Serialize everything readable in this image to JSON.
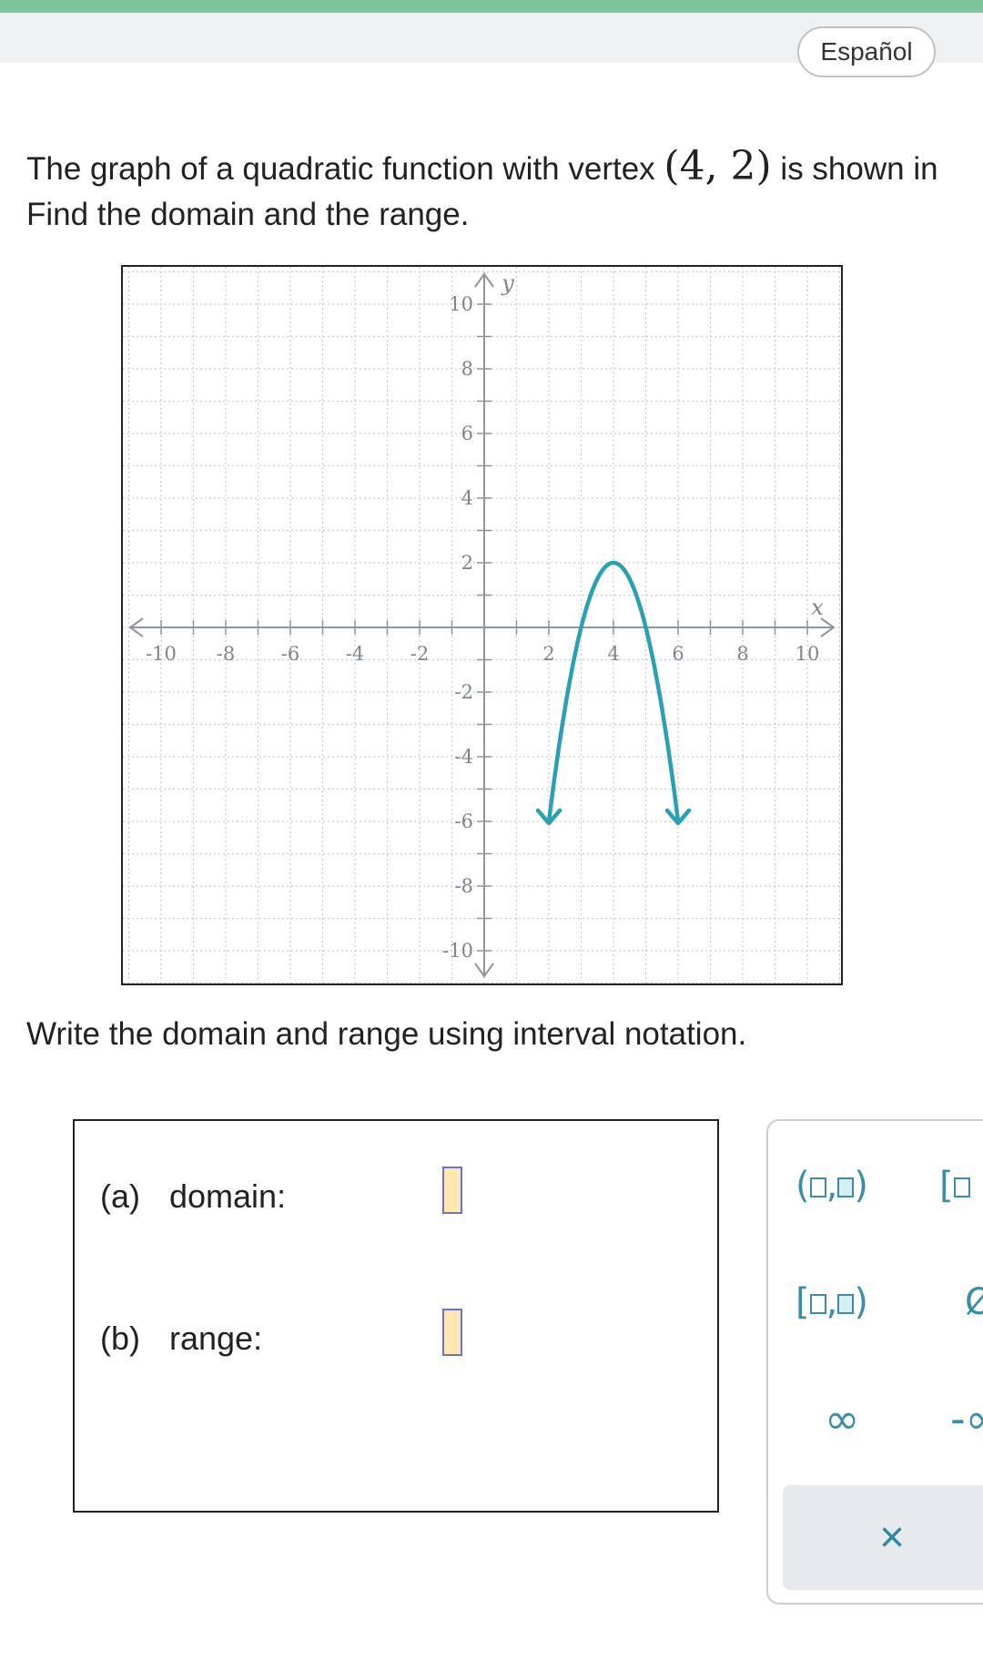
{
  "header": {
    "language_button": "Español"
  },
  "question": {
    "line1_text": "The graph of a quadratic function with vertex ",
    "vertex": "(4, 2)",
    "line1_suffix": " is shown in",
    "line2_text": "Find the domain and the range."
  },
  "instruction": "Write the domain and range using interval notation.",
  "answers": {
    "a_letter": "(a)",
    "a_label": "domain:",
    "b_letter": "(b)",
    "b_label": "range:"
  },
  "palette": {
    "open_open": "(□,□)",
    "closed_open": "[□",
    "closed_open_full": "[□,□)",
    "partial_item": "Ø",
    "infinity": "∞",
    "neg": "-∞",
    "clear_icon": "×"
  },
  "chart_data": {
    "type": "line",
    "title": "",
    "xlabel": "x",
    "ylabel": "y",
    "xlim": [
      -10,
      10
    ],
    "ylim": [
      -10,
      10
    ],
    "grid": true,
    "x_tick_labels": [
      "-10",
      "-8",
      "-6",
      "-4",
      "-2",
      "2",
      "4",
      "6",
      "8",
      "10"
    ],
    "y_tick_labels": [
      "10",
      "8",
      "6",
      "4",
      "2",
      "-2",
      "-4",
      "-6",
      "-8",
      "-10"
    ],
    "series": [
      {
        "function": "y = -2(x-4)^2 + 2",
        "vertex": [
          4,
          2
        ],
        "x_domain_drawn": [
          2,
          6
        ],
        "arrows_at_ends": true,
        "color": "#2aa0b4"
      }
    ]
  }
}
